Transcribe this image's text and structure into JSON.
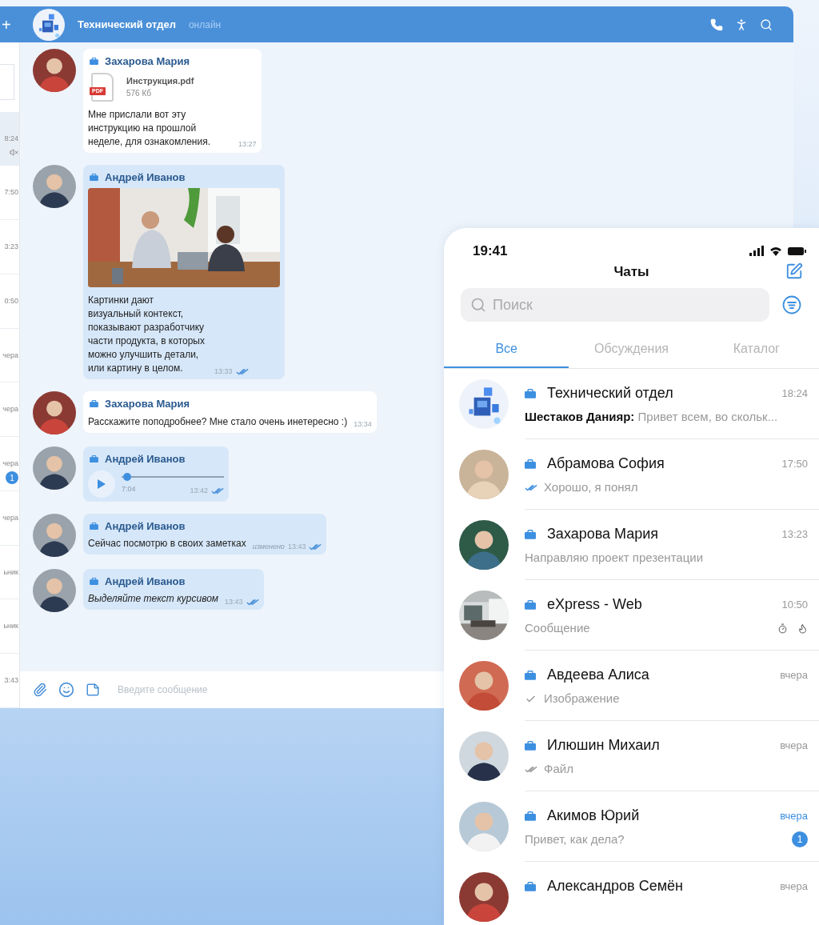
{
  "sidebar_strip": {
    "add_button": "+",
    "items": [
      {
        "time": "8:24",
        "selected": true,
        "muted": true
      },
      {
        "time": "7:50",
        "selected": false,
        "muted": false
      },
      {
        "time": "3:23",
        "selected": false,
        "muted": false
      },
      {
        "time": "0:50",
        "selected": false,
        "muted": false
      },
      {
        "time": "чера",
        "selected": false,
        "muted": false
      },
      {
        "time": "чера",
        "selected": false,
        "muted": false
      },
      {
        "time": "чера",
        "selected": false,
        "muted": false,
        "unread": "1"
      },
      {
        "time": "чера",
        "selected": false,
        "muted": false
      },
      {
        "time": "ьник",
        "selected": false,
        "muted": false
      },
      {
        "time": "ьник",
        "selected": false,
        "muted": false
      },
      {
        "time": "3:43",
        "selected": false,
        "muted": false
      }
    ]
  },
  "chat": {
    "title": "Технический отдел",
    "status": "онлайн",
    "messages": [
      {
        "kind": "file",
        "sender": "Захарова Мария",
        "outgoing": false,
        "read": false,
        "italic": false,
        "file_type": "PDF",
        "file_name": "Инструкция.pdf",
        "file_size": "576 Кб",
        "text": "Мне прислали вот эту инструкцию на прошлой неделе, для ознакомления.",
        "time": "13:27"
      },
      {
        "sender": "Андрей Иванов",
        "outgoing": true,
        "read": true,
        "italic": false,
        "text": "Картинки дают визуальный контекст, показывают разработчику части продукта, в которых можно улучшить детали, или картину в целом.",
        "time": "13:33"
      },
      {
        "kind": "text",
        "sender": "Захарова Мария",
        "outgoing": false,
        "read": false,
        "italic": false,
        "text": "Расскажите поподробнее? Мне стало очень инетересно :)",
        "time": "13:34"
      },
      {
        "kind": "voice",
        "sender": "Андрей Иванов",
        "outgoing": true,
        "read": true,
        "italic": false,
        "level": 0.03,
        "duration": "7:04",
        "time": "13:42"
      },
      {
        "kind": "text",
        "sender": "Андрей Иванов",
        "outgoing": true,
        "read": true,
        "italic": false,
        "edited_label": "изменено",
        "text": "Сейчас посмотрю в своих заметках",
        "time": "13:43"
      },
      {
        "kind": "text",
        "sender": "Андрей Иванов",
        "outgoing": true,
        "read": true,
        "italic": true,
        "text": "Выделяйте текст курсивом",
        "time": "13:43"
      }
    ],
    "composer": {
      "placeholder": "Введите сообщение"
    }
  },
  "phone": {
    "clock": "19:41",
    "title": "Чаты",
    "search": {
      "placeholder": "Поиск"
    },
    "tabs": [
      {
        "label": "Все",
        "selected": true
      },
      {
        "label": "Обсуждения",
        "selected": false
      },
      {
        "label": "Каталог",
        "selected": false
      }
    ],
    "chats": [
      {
        "kind": "group",
        "name": "Технический отдел",
        "time": "18:24",
        "sender": "Шестаков Данияр:",
        "preview": "Привет всем, во скольк...",
        "sent": false,
        "delivered": false,
        "read": false,
        "self_destruct": false
      },
      {
        "kind": "person",
        "name": "Абрамова София",
        "time": "17:50",
        "preview": "Хорошо, я понял",
        "sent": true,
        "delivered": true,
        "read": true,
        "self_destruct": false
      },
      {
        "kind": "person",
        "name": "Захарова Мария",
        "time": "13:23",
        "preview": "Направляю проект презентации",
        "sent": false,
        "delivered": false,
        "read": false,
        "self_destruct": false
      },
      {
        "kind": "room",
        "name": "eXpress - Web",
        "time": "10:50",
        "preview": "Сообщение",
        "sent": false,
        "delivered": false,
        "read": false,
        "self_destruct": true
      },
      {
        "kind": "person",
        "name": "Авдеева Алиса",
        "time": "вчера",
        "preview": "Изображение",
        "sent": true,
        "delivered": false,
        "read": false,
        "self_destruct": false
      },
      {
        "kind": "person",
        "name": "Илюшин Михаил",
        "time": "вчера",
        "preview": "Файл",
        "sent": true,
        "delivered": true,
        "read": false,
        "self_destruct": false
      },
      {
        "kind": "person",
        "name": "Акимов Юрий",
        "time": "вчера",
        "preview": "Привет, как дела?",
        "sent": false,
        "delivered": false,
        "read": false,
        "self_destruct": false,
        "unread": "1"
      },
      {
        "kind": "person",
        "name": "Александров Семён",
        "time": "вчера",
        "sent": false,
        "delivered": false,
        "read": false,
        "self_destruct": false
      }
    ]
  }
}
